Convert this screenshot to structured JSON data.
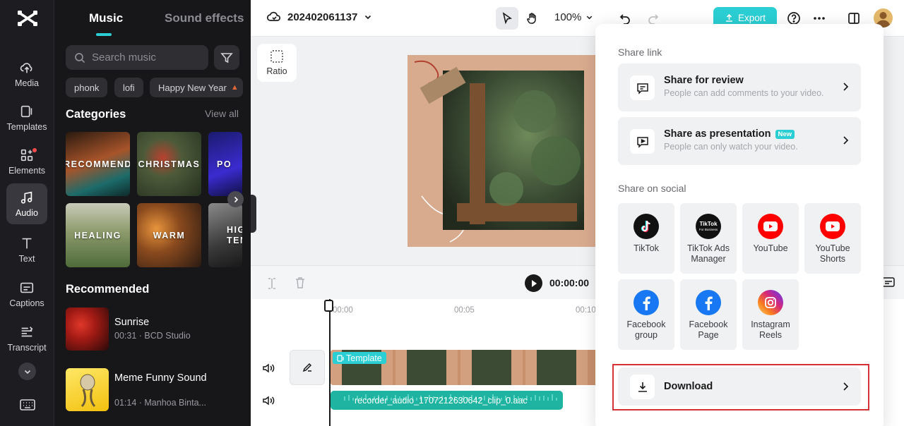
{
  "sidebar": {
    "items": [
      {
        "label": "Media",
        "icon": "cloud-upload-icon"
      },
      {
        "label": "Templates",
        "icon": "templates-icon"
      },
      {
        "label": "Elements",
        "icon": "elements-icon"
      },
      {
        "label": "Audio",
        "icon": "music-note-icon",
        "active": true
      },
      {
        "label": "Text",
        "icon": "text-icon"
      },
      {
        "label": "Captions",
        "icon": "captions-icon"
      },
      {
        "label": "Transcript",
        "icon": "transcript-icon"
      }
    ]
  },
  "music_panel": {
    "tabs": [
      {
        "label": "Music",
        "active": true
      },
      {
        "label": "Sound effects"
      }
    ],
    "search_placeholder": "Search music",
    "chips": [
      "phonk",
      "lofi",
      "Happy New Year"
    ],
    "categories_title": "Categories",
    "view_all": "View all",
    "categories": [
      "RECOMMEND",
      "CHRISTMAS",
      "PO",
      "HEALING",
      "WARM",
      "HIG TEM"
    ],
    "recommended_title": "Recommended",
    "tracks": [
      {
        "title": "Sunrise",
        "meta": "00:31 · BCD Studio"
      },
      {
        "title": "Meme Funny Sound",
        "meta": "01:14 · Manhoa Binta..."
      }
    ]
  },
  "topbar": {
    "project_name": "202402061137",
    "zoom": "100%",
    "export_label": "Export"
  },
  "canvas": {
    "ratio_label": "Ratio"
  },
  "player": {
    "timecode": "00:00:00"
  },
  "timeline": {
    "ticks": [
      "00:00",
      "00:05",
      "00:10"
    ],
    "template_tag": "Template",
    "audio_clip": "recorder_audio_1707212630642_clip_0.aac"
  },
  "share": {
    "share_link_title": "Share link",
    "review": {
      "title": "Share for review",
      "subtitle": "People can add comments to your video."
    },
    "presentation": {
      "title": "Share as presentation",
      "badge": "New",
      "subtitle": "People can only watch your video."
    },
    "social_title": "Share on social",
    "social": [
      {
        "label": "TikTok",
        "icon": "tiktok-icon"
      },
      {
        "label": "TikTok Ads Manager",
        "icon": "tiktok-business-icon"
      },
      {
        "label": "YouTube",
        "icon": "youtube-icon"
      },
      {
        "label": "YouTube Shorts",
        "icon": "youtube-shorts-icon"
      },
      {
        "label": "Facebook group",
        "icon": "facebook-icon"
      },
      {
        "label": "Facebook Page",
        "icon": "facebook-icon"
      },
      {
        "label": "Instagram Reels",
        "icon": "instagram-icon"
      }
    ],
    "download_label": "Download"
  },
  "colors": {
    "accent": "#2bcfd3",
    "highlight_outline": "#d63135"
  }
}
